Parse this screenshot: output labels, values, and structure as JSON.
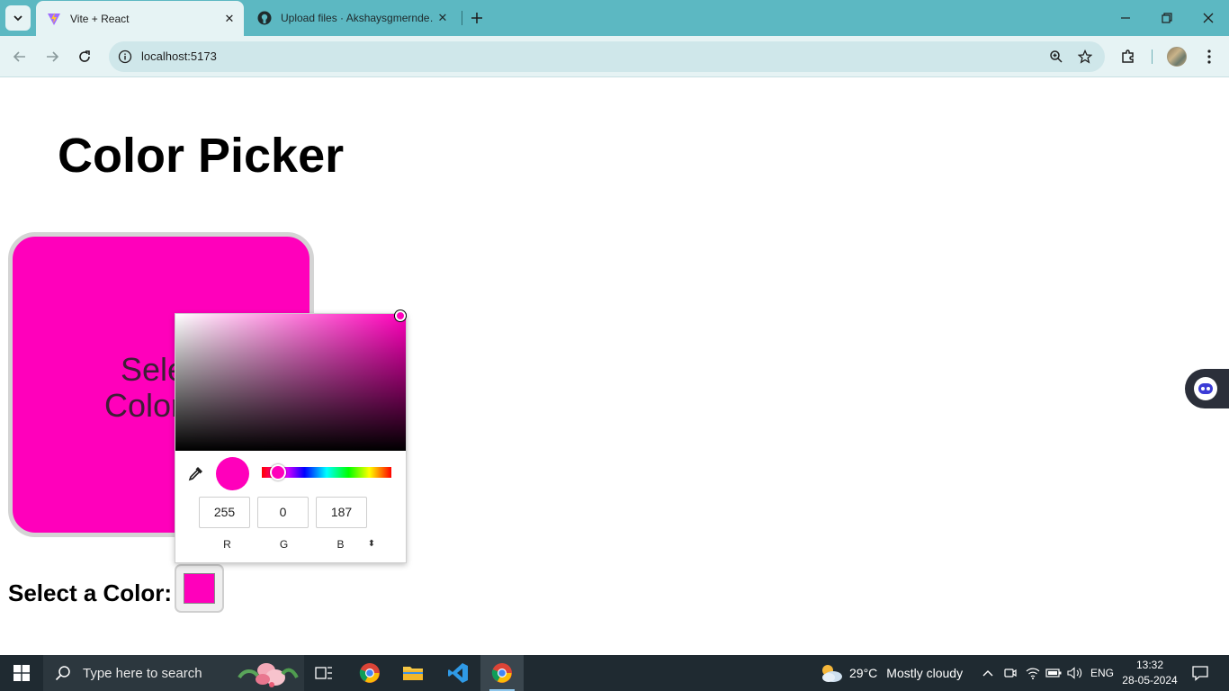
{
  "browser": {
    "tabs": [
      {
        "title": "Vite + React",
        "favicon": "vite-icon",
        "active": true
      },
      {
        "title": "Upload files · Akshaysgmernde…",
        "favicon": "github-icon",
        "active": false
      }
    ],
    "url": "localhost:5173"
  },
  "page": {
    "title": "Color Picker",
    "box_text_line1": "Selec",
    "box_text_line2": "Color:#f",
    "select_label": "Select a Color:",
    "selected_color": "#ff00bb"
  },
  "picker": {
    "r": "255",
    "g": "0",
    "b": "187",
    "r_label": "R",
    "g_label": "G",
    "b_label": "B",
    "mode_toggle": "⬍"
  },
  "taskbar": {
    "search_placeholder": "Type here to search",
    "weather_temp": "29°C",
    "weather_condition": "Mostly cloudy",
    "language": "ENG",
    "time": "13:32",
    "date": "28-05-2024"
  },
  "colors": {
    "accent_magenta": "#ff00bb",
    "tabbar": "#5cb8c2",
    "toolbar": "#e6f3f4",
    "taskbar": "#1f2a31"
  }
}
